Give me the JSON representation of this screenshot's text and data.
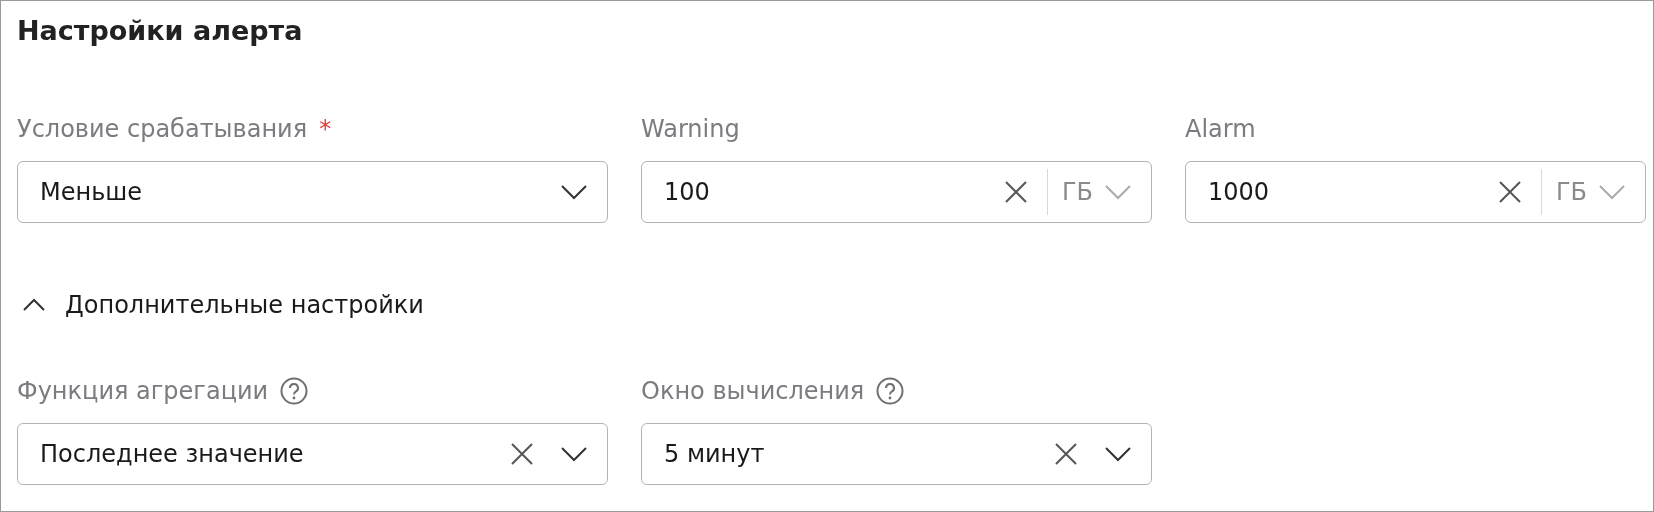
{
  "title": "Настройки алерта",
  "required_mark": "*",
  "fields": [
    {
      "label": "Условие срабатывания",
      "required": true,
      "kind": "select",
      "value": "Меньше"
    },
    {
      "label": "Warning",
      "required": false,
      "kind": "number",
      "value": "100",
      "unit": "ГБ"
    },
    {
      "label": "Alarm",
      "required": false,
      "kind": "number",
      "value": "1000",
      "unit": "ГБ"
    }
  ],
  "advanced": {
    "label": "Дополнительные настройки",
    "expanded": true
  },
  "advanced_fields": [
    {
      "label": "Функция агрегации",
      "help": true,
      "value": "Последнее значение",
      "clearable": true
    },
    {
      "label": "Окно вычисления",
      "help": true,
      "value": "5 минут",
      "clearable": true
    }
  ]
}
